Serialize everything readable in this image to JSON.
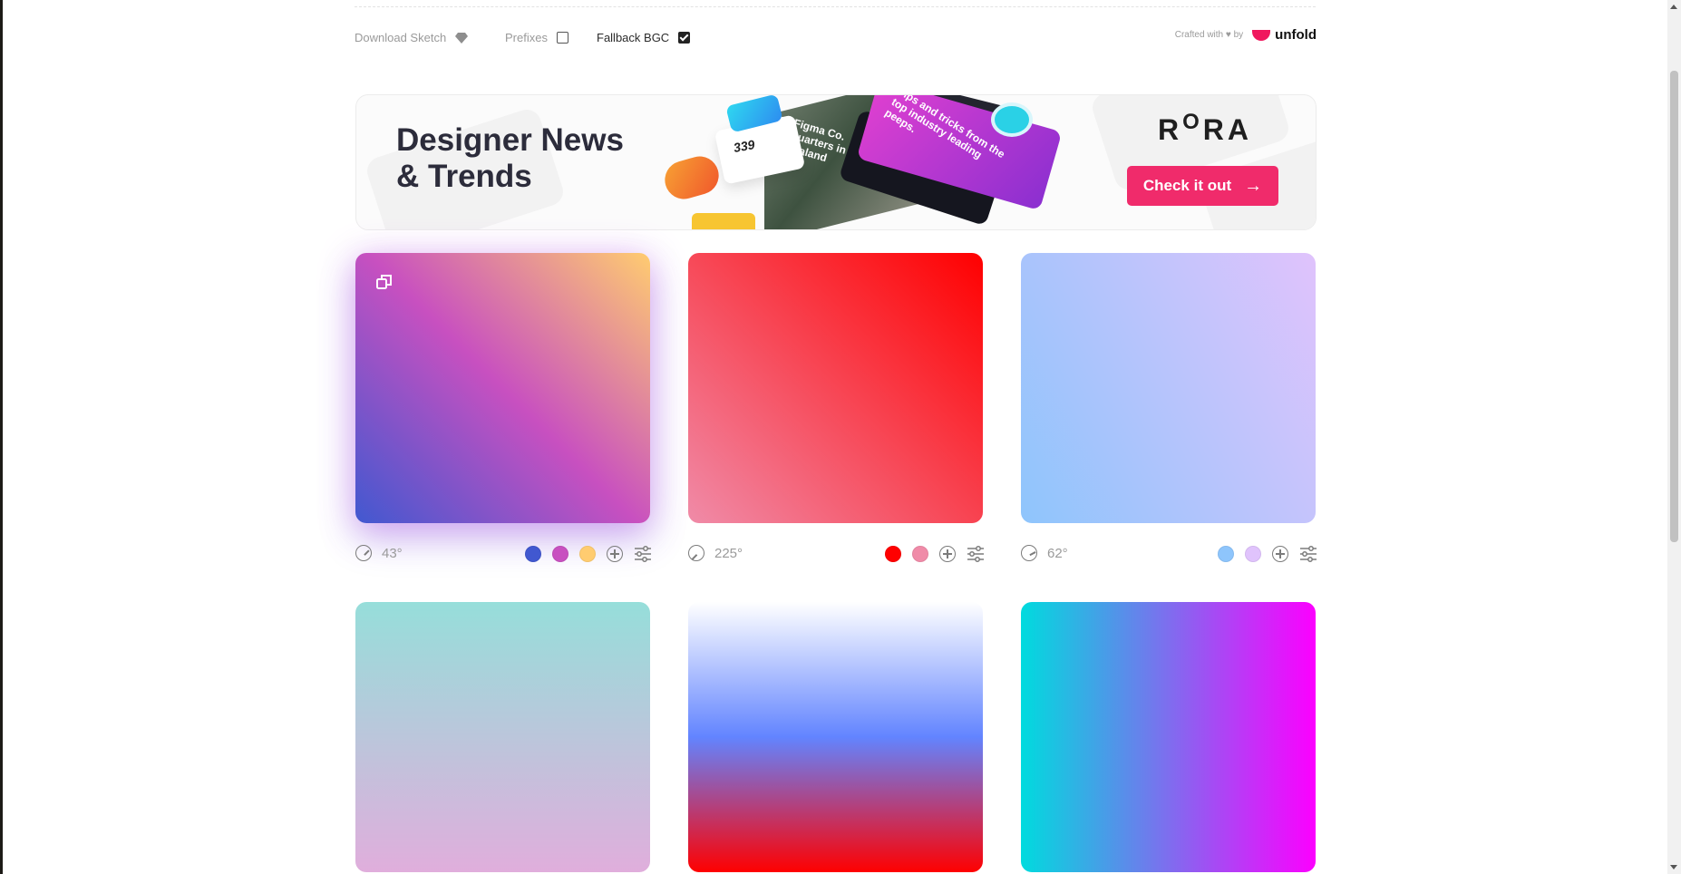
{
  "topbar": {
    "download_label": "Download Sketch",
    "prefixes_label": "Prefixes",
    "prefixes_checked": false,
    "fallback_label": "Fallback BGC",
    "fallback_checked": true,
    "credit_text": "Crafted with ♥ by",
    "credit_brand": "unfold"
  },
  "banner": {
    "title_line1": "Designer News",
    "title_line2": "& Trends",
    "collage_number": "339",
    "collage_headline_1": "Tips and tricks from the top industry leading peeps.",
    "collage_headline_2": "New Figma Co. Headquarters in New Zealand",
    "brand_letters": [
      "R",
      "O",
      "R",
      "A"
    ],
    "cta_label": "Check it out",
    "accent_color": "#f02b6b"
  },
  "gradients": [
    {
      "angle": "43°",
      "colors": [
        "#4158D0",
        "#C850C0",
        "#FFCC70"
      ],
      "highlighted": true
    },
    {
      "angle": "225°",
      "colors": [
        "#FF0000",
        "#F08BA8"
      ],
      "highlighted": false
    },
    {
      "angle": "62°",
      "colors": [
        "#8EC5FC",
        "#E0C3FC"
      ],
      "highlighted": false
    },
    {
      "angle": "",
      "colors": [
        "#96DEDA",
        "#E0AEDC"
      ],
      "highlighted": false
    },
    {
      "angle": "",
      "colors": [
        "#FFFFFF",
        "#6284FF",
        "#FF0000"
      ],
      "highlighted": false
    },
    {
      "angle": "",
      "colors": [
        "#00DBDE",
        "#FC00FF"
      ],
      "highlighted": false
    }
  ]
}
